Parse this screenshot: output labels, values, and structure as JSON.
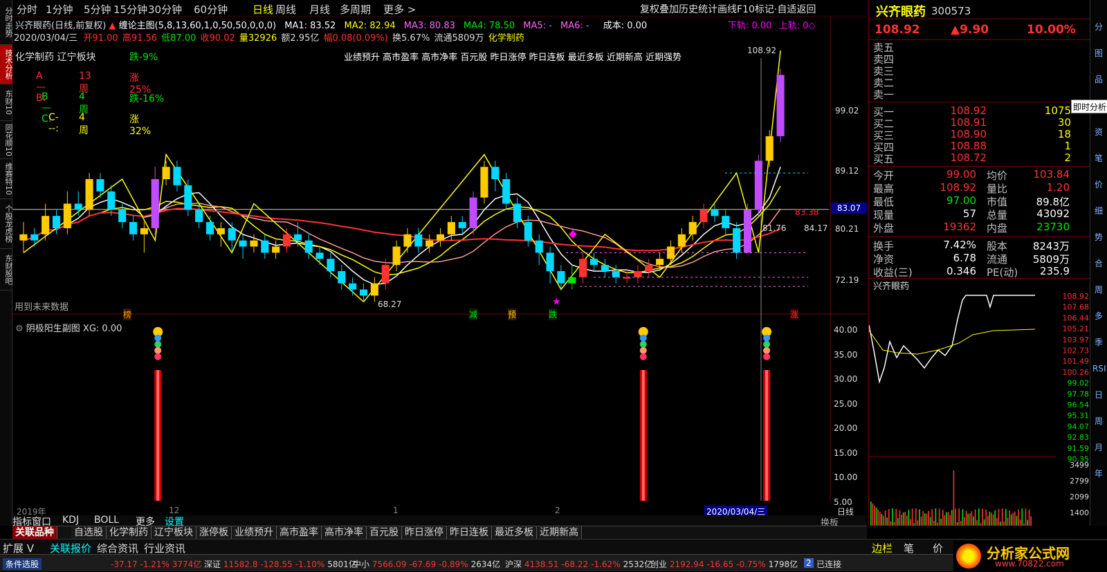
{
  "left_tabs": [
    "分时走势",
    "技术分析",
    "东财10",
    "同花顺10",
    "维赛特10",
    "个股龙虎榜",
    "东财股吧"
  ],
  "periods": [
    "分时",
    "1分钟",
    "5分钟",
    "15分钟",
    "30分钟",
    "60分钟",
    "日线",
    "周线",
    "月线",
    "多周期",
    "更多 >"
  ],
  "period_active": "日线",
  "top_right_menu": "复权叠加历史统计画线F10标记·自适返回",
  "stock": {
    "name": "兴齐眼药",
    "code": "300573",
    "price": "108.92",
    "change": "▲9.90",
    "pct": "10.00%"
  },
  "main_info": {
    "title": "兴齐眼药(日线,前复权)",
    "indicator": "缠论主图(5,8,13,60,1,0,50,50,0,0,0)",
    "ma1": "MA1: 83.52",
    "ma2": "MA2: 82.94",
    "ma3": "MA3: 80.83",
    "ma4": "MA4: 78.50",
    "ma5": "MA5: -",
    "ma6": "MA6: -",
    "cost": "成本: 0.00",
    "down": "下轨: 0.00",
    "up": "上轨: 0◇",
    "date": "2020/03/04/三",
    "open": "开91.00",
    "high": "高91.56",
    "low": "低87.00",
    "close": "收90.02",
    "vol": "量32926",
    "amt": "额2.95亿",
    "rng": "幅0.08(0.09%)",
    "turn": "换5.67%",
    "flow": "流通5809万",
    "sector": "化学制药"
  },
  "annotations": {
    "sector_label": "化学制药",
    "sector_label2": "辽宁板块",
    "a_line": "A—B:",
    "a_w": "13周",
    "a_p": "涨25%",
    "b_line": "B—C:",
    "b_w": "4周",
    "b_p": "跌-16%",
    "c_line": "C---:",
    "c_w": "4周",
    "c_p": "涨32%",
    "top_p": "跌-9%",
    "concepts": "业绩预升 高市盈率 高市净率 百元股 昨日涨停 昨日连板 最近多板 近期新高 近期强势",
    "future": "用到未来数据",
    "low_price": "68.27",
    "high_price": "108.92",
    "mid_price": "84.17",
    "cur_price": "83.07",
    "tag1": "榜",
    "tag2": "减",
    "tag3": "预",
    "tag4": "跌",
    "tag5": "涨",
    "ma_tag": "83.38",
    "p1": "81.76"
  },
  "price_axis": [
    "99.02",
    "89.12",
    "80.21",
    "72.19"
  ],
  "sub_chart": {
    "title": "阴极阳生副图 XG: 0.00",
    "axis": [
      "40.00",
      "35.00",
      "30.00",
      "25.00",
      "20.00",
      "15.00",
      "10.00",
      "5.00"
    ]
  },
  "time_axis": {
    "year": "2019年",
    "m12": "12",
    "m1": "1",
    "m2": "2",
    "current": "2020/03/04/三",
    "period": "日线"
  },
  "indicator_tabs": [
    "指标窗口",
    "KDJ",
    "BOLL",
    "更多",
    "设置"
  ],
  "indicator_tab_active": "设置",
  "sub_panel_tag": "换板",
  "order_book": {
    "sell": [
      "卖五",
      "卖四",
      "卖三",
      "卖二",
      "卖一"
    ],
    "buy": [
      {
        "label": "买一",
        "price": "108.92",
        "vol": "1075"
      },
      {
        "label": "买二",
        "price": "108.91",
        "vol": "30"
      },
      {
        "label": "买三",
        "price": "108.90",
        "vol": "18"
      },
      {
        "label": "买四",
        "price": "108.88",
        "vol": "1"
      },
      {
        "label": "买五",
        "price": "108.72",
        "vol": "2"
      }
    ],
    "tooltip": "即时分析"
  },
  "stats_left": [
    {
      "label": "今开",
      "value": "99.00",
      "color": "#ff3232"
    },
    {
      "label": "最高",
      "value": "108.92",
      "color": "#ff3232"
    },
    {
      "label": "最低",
      "value": "97.00",
      "color": "#00e600"
    },
    {
      "label": "现量",
      "value": "57",
      "color": "#ffffff"
    },
    {
      "label": "外盘",
      "value": "19362",
      "color": "#ff3232"
    }
  ],
  "stats_right": [
    {
      "label": "均价",
      "value": "103.84",
      "color": "#ff3232"
    },
    {
      "label": "量比",
      "value": "1.20",
      "color": "#ff3232"
    },
    {
      "label": "市值",
      "value": "89.8亿",
      "color": "#ffffff"
    },
    {
      "label": "总量",
      "value": "43092",
      "color": "#ffffff"
    },
    {
      "label": "内盘",
      "value": "23730",
      "color": "#00e600"
    }
  ],
  "stats2_left": [
    {
      "label": "换手",
      "value": "7.42%"
    },
    {
      "label": "净资",
      "value": "6.78"
    },
    {
      "label": "收益(三)",
      "value": "0.346"
    }
  ],
  "stats2_right": [
    {
      "label": "股本",
      "value": "8243万"
    },
    {
      "label": "流通",
      "value": "5809万"
    },
    {
      "label": "PE(动)",
      "value": "235.9"
    }
  ],
  "mini_chart": {
    "title": "兴齐眼药",
    "axis": [
      "108.92",
      "107.68",
      "106.44",
      "105.21",
      "103.97",
      "102.73",
      "101.49",
      "100.26",
      "99.02",
      "97.78",
      "96.54",
      "95.31",
      "94.07",
      "92.83",
      "91.59",
      "90.35"
    ],
    "vol_axis": [
      "3499",
      "2799",
      "2099",
      "1400"
    ]
  },
  "right_bottom_tabs": [
    "边栏",
    "笔",
    "价",
    "细",
    "势"
  ],
  "icon_strip": [
    "分",
    "图",
    "品",
    "报",
    "资",
    "笔",
    "价",
    "细",
    "势",
    "合",
    "周",
    "多",
    "季",
    "RSI",
    "日",
    "周",
    "月",
    "年"
  ],
  "bottom_tabs": [
    "关联品种",
    "自选股",
    "化学制药",
    "辽宁板块",
    "涨停板",
    "业绩预升",
    "高市盈率",
    "高市净率",
    "百元股",
    "昨日涨停",
    "昨日连板",
    "最近多板",
    "近期新高"
  ],
  "bottom_tab_active": "关联品种",
  "bottom_tabs2": [
    "扩展 V",
    "关联报价",
    "综合资讯",
    "行业资讯"
  ],
  "status": {
    "label": "条件选股",
    "first": "-37.17 -1.21% 3774亿",
    "items": [
      {
        "name": "深证",
        "val": "11582.8",
        "chg": "-128.55",
        "pct": "-1.10%",
        "amt": "5801亿"
      },
      {
        "name": "中小",
        "val": "7566.09",
        "chg": "-67.69",
        "pct": "-0.89%",
        "amt": "2634亿"
      },
      {
        "name": "沪深",
        "val": "4138.51",
        "chg": "-68.22",
        "pct": "-1.62%",
        "amt": "2532亿"
      },
      {
        "name": "创业",
        "val": "2192.94",
        "chg": "-16.65",
        "pct": "-0.75%",
        "amt": "1798亿"
      }
    ],
    "conn": "已连接",
    "conn_num": "2"
  },
  "watermark": {
    "cn": "分析家公式网",
    "url": "www.70822.com"
  },
  "candles": [
    [
      79,
      78,
      81,
      76
    ],
    [
      78,
      79,
      80,
      77
    ],
    [
      79,
      82,
      84,
      78
    ],
    [
      82,
      80,
      83,
      79
    ],
    [
      80,
      84,
      86,
      79
    ],
    [
      84,
      83,
      86,
      82
    ],
    [
      83,
      88,
      89,
      82
    ],
    [
      88,
      86,
      89,
      85
    ],
    [
      86,
      83,
      87,
      82
    ],
    [
      83,
      81,
      84,
      80
    ],
    [
      81,
      79,
      82,
      78
    ],
    [
      79,
      80,
      81,
      76
    ],
    [
      80,
      88,
      90,
      79
    ],
    [
      88,
      90,
      91,
      87
    ],
    [
      90,
      87,
      91,
      86
    ],
    [
      87,
      83,
      88,
      82
    ],
    [
      83,
      81,
      84,
      80
    ],
    [
      81,
      79,
      82,
      78
    ],
    [
      79,
      80,
      81,
      77
    ],
    [
      80,
      78,
      81,
      76
    ],
    [
      78,
      77,
      79,
      75
    ],
    [
      77,
      78,
      79,
      76
    ],
    [
      78,
      76,
      79,
      75
    ],
    [
      76,
      77,
      78,
      75
    ],
    [
      77,
      79,
      80,
      76
    ],
    [
      79,
      78,
      81,
      77
    ],
    [
      78,
      76,
      79,
      75
    ],
    [
      76,
      75,
      77,
      74
    ],
    [
      75,
      73,
      76,
      72
    ],
    [
      73,
      71,
      74,
      70
    ],
    [
      71,
      70,
      72,
      69
    ],
    [
      70,
      69,
      71,
      68
    ],
    [
      69,
      71,
      72,
      68
    ],
    [
      71,
      74,
      75,
      70
    ],
    [
      74,
      77,
      78,
      73
    ],
    [
      77,
      79,
      80,
      76
    ],
    [
      79,
      77,
      80,
      76
    ],
    [
      77,
      78,
      79,
      76
    ],
    [
      78,
      79,
      80,
      77
    ],
    [
      79,
      81,
      82,
      78
    ],
    [
      81,
      80,
      82,
      79
    ],
    [
      80,
      85,
      86,
      79
    ],
    [
      85,
      90,
      91,
      84
    ],
    [
      90,
      88,
      91,
      86
    ],
    [
      88,
      84,
      89,
      83
    ],
    [
      84,
      81,
      85,
      80
    ],
    [
      81,
      78,
      82,
      77
    ],
    [
      78,
      76,
      79,
      74
    ],
    [
      76,
      73,
      77,
      71
    ],
    [
      73,
      71,
      74,
      70
    ],
    [
      71,
      72,
      74,
      70
    ],
    [
      72,
      75,
      76,
      71
    ],
    [
      75,
      74,
      76,
      73
    ],
    [
      74,
      73,
      75,
      72
    ],
    [
      73,
      72,
      74,
      71
    ],
    [
      72,
      72,
      73,
      71
    ],
    [
      72,
      73,
      74,
      71
    ],
    [
      73,
      74,
      75,
      72
    ],
    [
      74,
      75,
      76,
      73
    ],
    [
      75,
      77,
      78,
      74
    ],
    [
      77,
      79,
      80,
      76
    ],
    [
      79,
      81,
      82,
      78
    ],
    [
      81,
      83,
      84,
      80
    ],
    [
      83,
      82,
      84,
      81
    ],
    [
      82,
      80,
      83,
      79
    ],
    [
      80,
      76,
      81,
      75
    ],
    [
      76,
      83,
      84,
      76
    ],
    [
      83,
      91,
      92,
      82
    ],
    [
      91,
      95,
      96,
      90
    ],
    [
      95,
      105,
      106,
      94
    ]
  ],
  "candle_colors": [
    "#ffcc00",
    "#00d9ff",
    "#ffcc00",
    "#00d9ff",
    "#ffcc00",
    "#00d9ff",
    "#ffcc00",
    "#00d9ff",
    "#00d9ff",
    "#00d9ff",
    "#00d9ff",
    "#ffcc00",
    "#c04bff",
    "#ffcc00",
    "#00d9ff",
    "#00d9ff",
    "#00d9ff",
    "#00d9ff",
    "#ffcc00",
    "#00d9ff",
    "#00d9ff",
    "#ffcc00",
    "#00d9ff",
    "#ffcc00",
    "#ff3232",
    "#00d9ff",
    "#00d9ff",
    "#00d9ff",
    "#00d9ff",
    "#00d9ff",
    "#00d9ff",
    "#00d9ff",
    "#ffcc00",
    "#ff3232",
    "#ffcc00",
    "#ffcc00",
    "#00d9ff",
    "#ffcc00",
    "#ffcc00",
    "#ffcc00",
    "#00d9ff",
    "#c04bff",
    "#ffcc00",
    "#00d9ff",
    "#00d9ff",
    "#00d9ff",
    "#00d9ff",
    "#00d9ff",
    "#00d9ff",
    "#00d9ff",
    "#00e600",
    "#ff3232",
    "#00d9ff",
    "#00d9ff",
    "#00d9ff",
    "#ff3232",
    "#ff3232",
    "#ff3232",
    "#ffcc00",
    "#ffcc00",
    "#ffcc00",
    "#ffcc00",
    "#ff3232",
    "#00d9ff",
    "#00d9ff",
    "#00d9ff",
    "#c04bff",
    "#c04bff",
    "#ffcc00",
    "#c04bff"
  ],
  "colors": {
    "up": "#ff3232",
    "down": "#00e600",
    "accent": "#ffff00",
    "bg": "#000000"
  }
}
